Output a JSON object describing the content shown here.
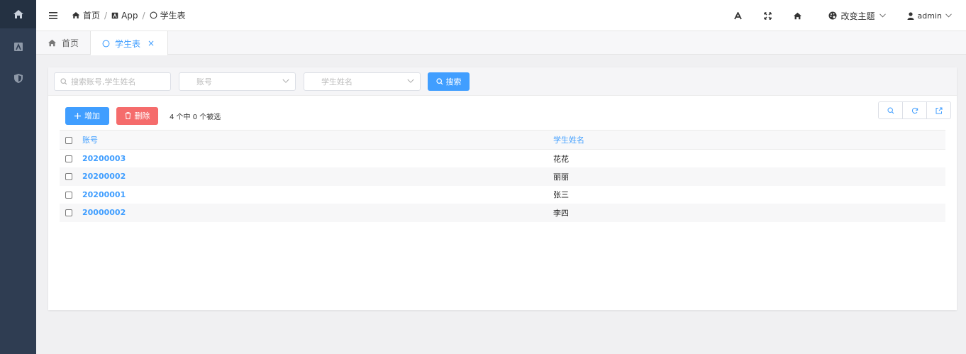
{
  "breadcrumb": [
    {
      "icon": "home-icon",
      "label": "首页"
    },
    {
      "icon": "app-icon",
      "label": "App"
    },
    {
      "icon": "circle-icon",
      "label": "学生表"
    }
  ],
  "header": {
    "theme_label": "改变主题",
    "user_label": "admin"
  },
  "tabs": [
    {
      "icon": "home-icon",
      "label": "首页",
      "active": false
    },
    {
      "icon": "circle-icon",
      "label": "学生表",
      "active": true,
      "close": "×"
    }
  ],
  "filters": {
    "search_placeholder": "搜索账号,学生姓名",
    "account_placeholder": "账号",
    "name_placeholder": "学生姓名",
    "search_button": "搜索"
  },
  "toolbar": {
    "add_label": "增加",
    "delete_label": "删除",
    "selection_text": "4 个中 0 个被选"
  },
  "table": {
    "columns": [
      "账号",
      "学生姓名"
    ],
    "rows": [
      {
        "account": "20200003",
        "name": "花花"
      },
      {
        "account": "20200002",
        "name": "丽丽"
      },
      {
        "account": "20200001",
        "name": "张三"
      },
      {
        "account": "20000002",
        "name": "李四"
      }
    ]
  },
  "colors": {
    "sidebar": "#2f3d52",
    "primary": "#409eff",
    "danger": "#f56c6c"
  }
}
